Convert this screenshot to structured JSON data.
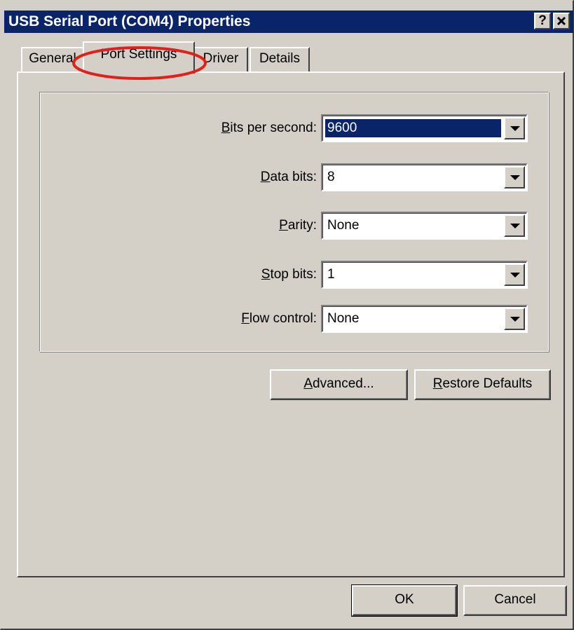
{
  "window": {
    "title": "USB Serial Port (COM4) Properties",
    "help_button": "?",
    "close_button": "✕"
  },
  "tabs": [
    {
      "label": "General"
    },
    {
      "label": "Port Settings",
      "active": true
    },
    {
      "label": "Driver"
    },
    {
      "label": "Details"
    }
  ],
  "port_settings": {
    "bits_per_second": {
      "label_accel": "B",
      "label_rest": "its per second:",
      "value": "9600"
    },
    "data_bits": {
      "label_accel": "D",
      "label_rest": "ata bits:",
      "value": "8"
    },
    "parity": {
      "label_accel": "P",
      "label_rest": "arity:",
      "value": "None"
    },
    "stop_bits": {
      "label_accel": "S",
      "label_rest": "top bits:",
      "value": "1"
    },
    "flow_control": {
      "label_accel": "F",
      "label_rest": "low control:",
      "value": "None"
    }
  },
  "buttons": {
    "advanced_accel": "A",
    "advanced_rest": "dvanced...",
    "restore_accel": "R",
    "restore_rest": "estore Defaults",
    "ok": "OK",
    "cancel": "Cancel"
  },
  "colors": {
    "title_bar": "#0a246a",
    "face": "#d4d0c8",
    "annotation": "#e0201a"
  }
}
